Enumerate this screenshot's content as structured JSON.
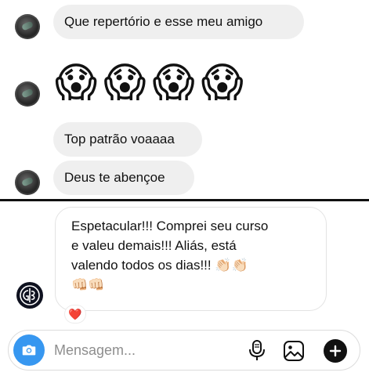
{
  "messages": {
    "m1": {
      "text": "Que repertório e esse meu amigo"
    },
    "m2": {
      "emojis": [
        "😱",
        "😱",
        "😱",
        "😱"
      ]
    },
    "m3": {
      "text": "Top patrão voaaaa"
    },
    "m4": {
      "text": "Deus te abençoe"
    },
    "m5": {
      "lines": [
        "Espetacular!!! Comprei seu curso",
        "e valeu demais!!! Aliás, está",
        "valendo todos os dias!!! 👏🏻👏🏻",
        "👊🏻👊🏻"
      ],
      "reaction": "❤️"
    }
  },
  "avatar_gs": {
    "initials": "GS"
  },
  "composer": {
    "placeholder": "Mensagem..."
  },
  "icons": {
    "camera": "camera-icon",
    "mic": "microphone-icon",
    "gallery": "image-gallery-icon",
    "plus": "plus-icon"
  },
  "colors": {
    "accent": "#3797f0",
    "bubble_gray": "#efefef",
    "heart": "#e0245e"
  }
}
